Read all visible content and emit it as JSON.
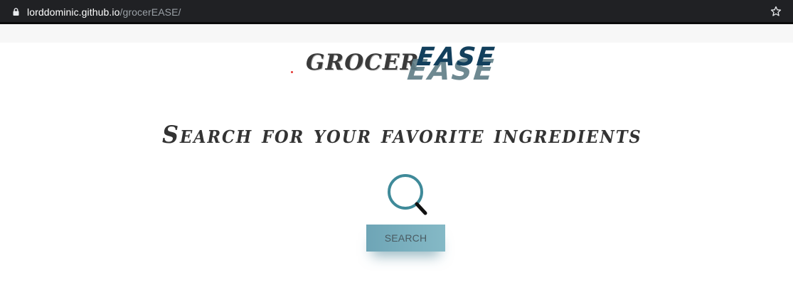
{
  "browser": {
    "url_host": "lorddominic.github.io",
    "url_path": "/grocerEASE/",
    "lock_icon": "lock-icon",
    "bookmark_icon": "star-icon"
  },
  "logo": {
    "part1": "GROCER",
    "part2": "EASE"
  },
  "headline": "Search for your favorite ingredients",
  "search": {
    "icon": "magnifier-icon",
    "button_label": "SEARCH"
  },
  "colors": {
    "accent": "#3f8a99",
    "button": "#78adbd",
    "logo_dark": "#123f5c"
  }
}
